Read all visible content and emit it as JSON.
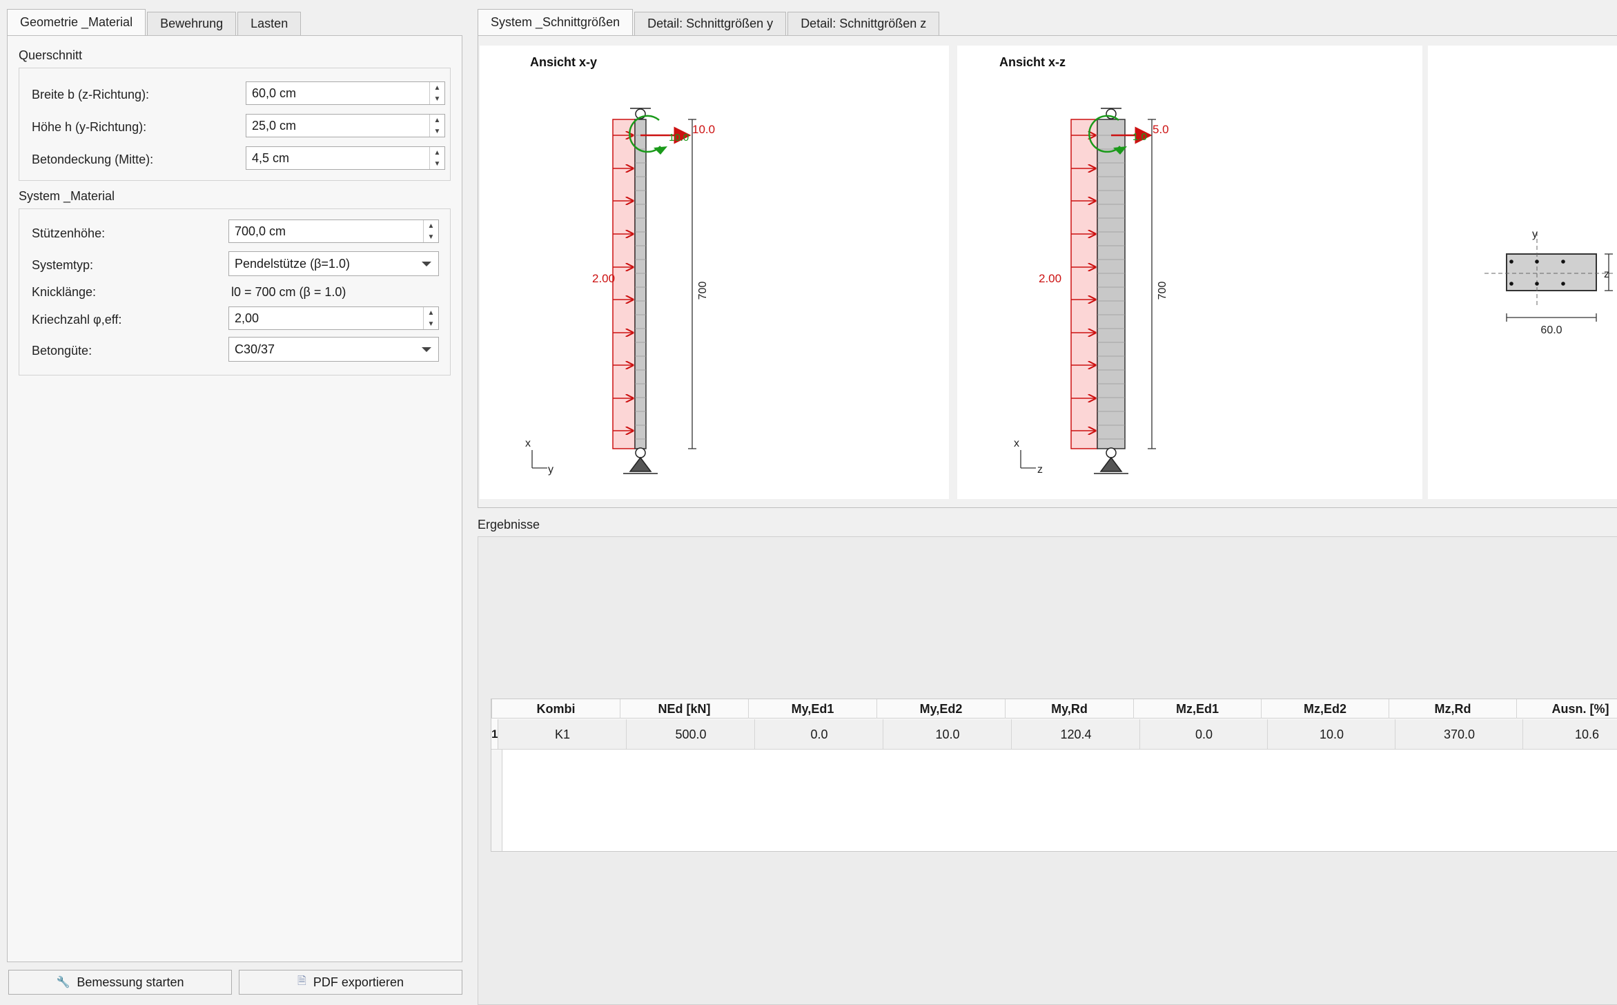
{
  "left_tabs": [
    "Geometrie _Material",
    "Bewehrung",
    "Lasten"
  ],
  "querschnitt": {
    "title": "Querschnitt",
    "breite_label": "Breite b (z-Richtung):",
    "breite_value": "60,0 cm",
    "hoehe_label": "Höhe h (y-Richtung):",
    "hoehe_value": "25,0 cm",
    "deckung_label": "Betondeckung (Mitte):",
    "deckung_value": "4,5 cm"
  },
  "system": {
    "title": "System _Material",
    "stuetzenhoehe_label": "Stützenhöhe:",
    "stuetzenhoehe_value": "700,0 cm",
    "systemtyp_label": "Systemtyp:",
    "systemtyp_value": "Pendelstütze (β=1.0)",
    "knicklaenge_label": "Knicklänge:",
    "knicklaenge_value": "l0 = 700 cm (β = 1.0)",
    "kriechzahl_label": "Kriechzahl φ,eff:",
    "kriechzahl_value": "2,00",
    "betonguete_label": "Betongüte:",
    "betonguete_value": "C30/37"
  },
  "buttons": {
    "bemessung": "Bemessung starten",
    "pdf": "PDF exportieren"
  },
  "right_tabs": [
    "System _Schnittgrößen",
    "Detail: Schnittgrößen y",
    "Detail: Schnittgrößen z"
  ],
  "views": {
    "xy": {
      "title": "Ansicht x-y",
      "load_left": "2.00",
      "load_top": "10.0",
      "moment_label": "10.0",
      "height_dim": "700",
      "axis_a": "x",
      "axis_b": "y"
    },
    "xz": {
      "title": "Ansicht x-z",
      "load_left": "2.00",
      "load_top": "5.0",
      "moment_label": "1.0",
      "height_dim": "700",
      "axis_a": "x",
      "axis_b": "z"
    },
    "section": {
      "axis_y": "y",
      "axis_z": "z",
      "width_dim": "60.0"
    }
  },
  "results": {
    "title": "Ergebnisse",
    "columns": [
      "Kombi",
      "NEd [kN]",
      "My,Ed1",
      "My,Ed2",
      "My,Rd",
      "Mz,Ed1",
      "Mz,Ed2",
      "Mz,Rd",
      "Ausn. [%]"
    ],
    "rows": [
      {
        "index": "1",
        "cells": [
          "K1",
          "500.0",
          "0.0",
          "10.0",
          "120.4",
          "0.0",
          "10.0",
          "370.0",
          "10.6"
        ]
      }
    ]
  },
  "colors": {
    "load": "#cc1111",
    "load_fill": "#fcd6d6",
    "moment": "#1a9a1a",
    "column": "#c8c8c8"
  }
}
